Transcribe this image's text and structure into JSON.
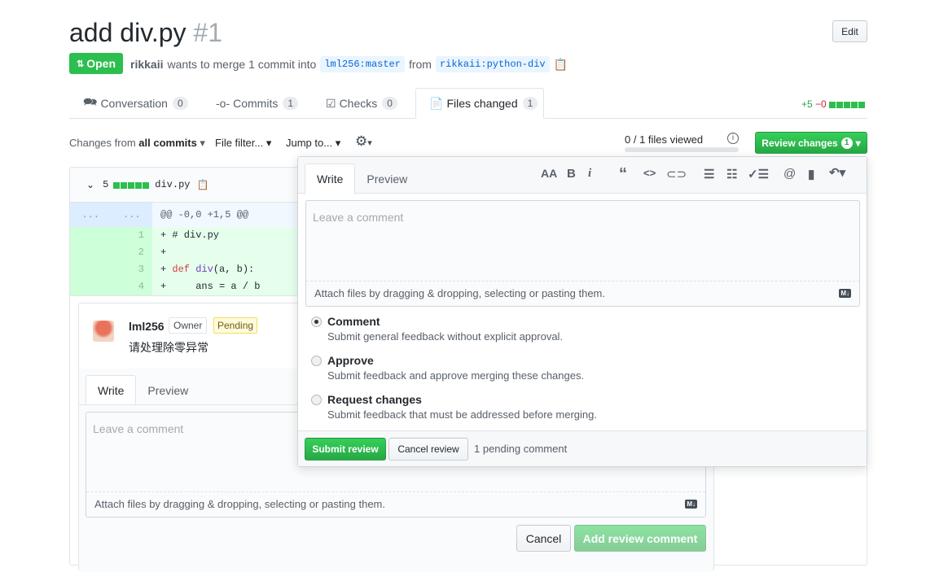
{
  "header": {
    "title": "add div.py",
    "number": "#1",
    "edit_label": "Edit",
    "state": "Open",
    "author": "rikkaii",
    "merge_text": "wants to merge 1 commit into",
    "base": "lml256:master",
    "from": "from",
    "head": "rikkaii:python-div"
  },
  "tabs": [
    {
      "label": "Conversation",
      "count": "0",
      "icon": "comment-discussion-icon"
    },
    {
      "label": "Commits",
      "count": "1",
      "icon": "git-commit-icon"
    },
    {
      "label": "Checks",
      "count": "0",
      "icon": "checklist-icon"
    },
    {
      "label": "Files changed",
      "count": "1",
      "icon": "file-diff-icon"
    }
  ],
  "diffstat": {
    "added": "+5",
    "removed": "−0",
    "blocks": 5
  },
  "toolbar": {
    "changes_prefix": "Changes from",
    "changes_value": "all commits",
    "file_filter": "File filter...",
    "jump_to": "Jump to...",
    "files_viewed": "0 / 1 files viewed",
    "files_viewed_progress": 0,
    "review_changes": "Review changes",
    "review_count": "1"
  },
  "file": {
    "changes": "5",
    "name": "div.py",
    "hunk": "@@ -0,0 +1,5 @@",
    "hunk_nums": [
      "...",
      "..."
    ],
    "lines": [
      {
        "num": "1",
        "code": "+ # div.py"
      },
      {
        "num": "2",
        "code": "+"
      },
      {
        "num": "3",
        "code": "+ def div(a, b):"
      },
      {
        "num": "4",
        "code": "+     ans = a / b"
      }
    ]
  },
  "comment": {
    "author": "lml256",
    "role": "Owner",
    "status": "Pending",
    "body": "请处理除零异常",
    "write": "Write",
    "preview": "Preview",
    "placeholder": "Leave a comment",
    "attach": "Attach files by dragging & dropping, selecting or pasting them.",
    "cancel": "Cancel",
    "submit": "Add review comment"
  },
  "review": {
    "write": "Write",
    "preview": "Preview",
    "placeholder": "Leave a comment",
    "attach": "Attach files by dragging & dropping, selecting or pasting them.",
    "markdown_badge": "M↓",
    "options": [
      {
        "label": "Comment",
        "desc": "Submit general feedback without explicit approval.",
        "selected": true
      },
      {
        "label": "Approve",
        "desc": "Submit feedback and approve merging these changes.",
        "selected": false
      },
      {
        "label": "Request changes",
        "desc": "Submit feedback that must be addressed before merging.",
        "selected": false
      }
    ],
    "submit": "Submit review",
    "cancel": "Cancel review",
    "pending": "1 pending comment"
  },
  "colors": {
    "green": "#2cbe4e",
    "link": "#0366d6",
    "red": "#cb2431"
  }
}
